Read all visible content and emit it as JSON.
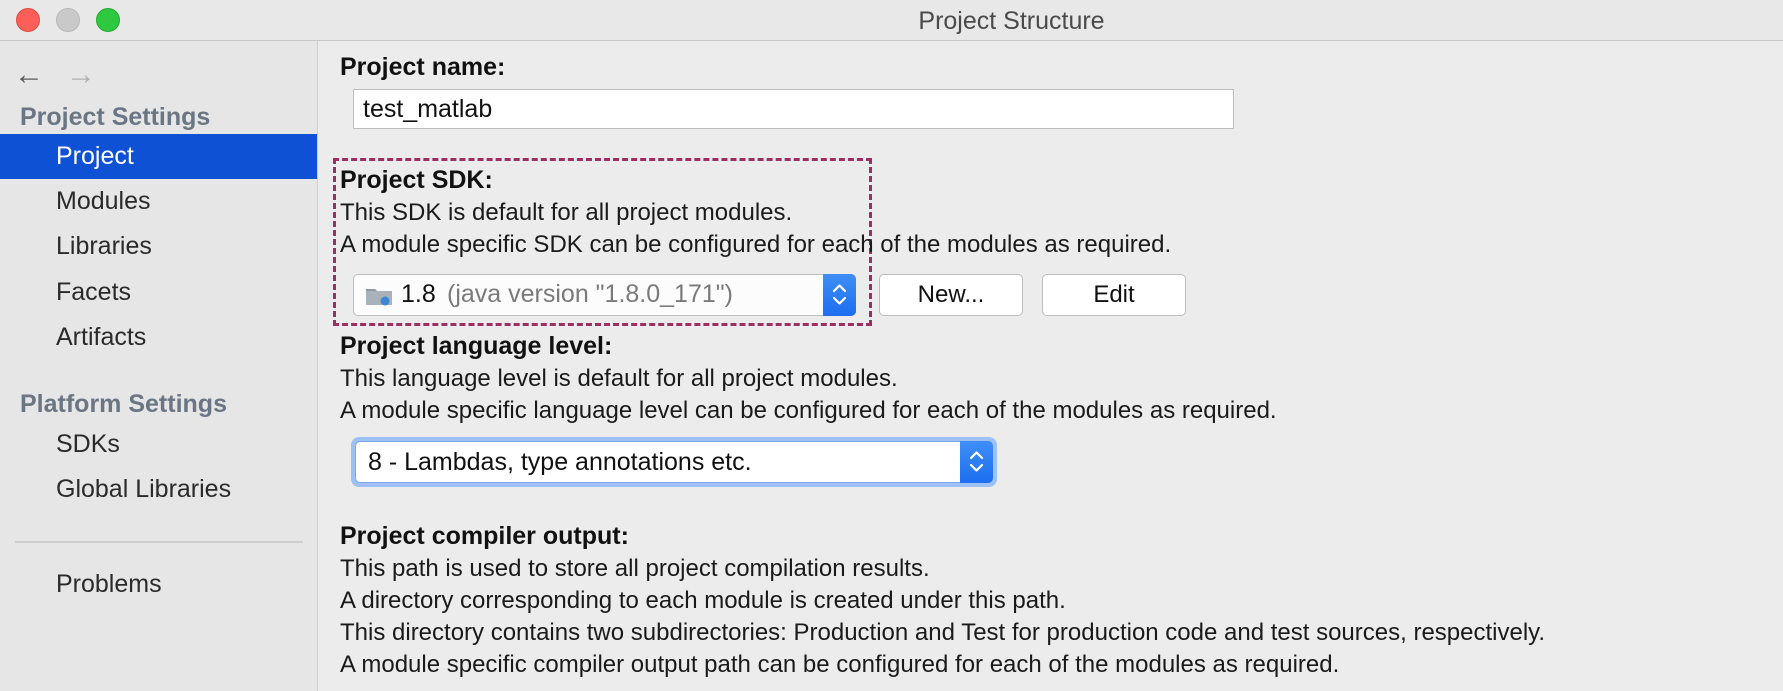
{
  "window": {
    "title": "Project Structure"
  },
  "sidebar": {
    "nav": {
      "back_icon": "←",
      "forward_icon": "→"
    },
    "sections": [
      {
        "header": "Project Settings",
        "items": [
          {
            "label": "Project",
            "selected": true
          },
          {
            "label": "Modules"
          },
          {
            "label": "Libraries"
          },
          {
            "label": "Facets"
          },
          {
            "label": "Artifacts"
          }
        ]
      },
      {
        "header": "Platform Settings",
        "items": [
          {
            "label": "SDKs"
          },
          {
            "label": "Global Libraries"
          }
        ]
      }
    ],
    "problems_label": "Problems"
  },
  "main": {
    "project_name": {
      "label": "Project name:",
      "value": "test_matlab"
    },
    "sdk": {
      "label": "Project SDK:",
      "desc1": "This SDK is default for all project modules.",
      "desc2": "A module specific SDK can be configured for each of the modules as required.",
      "selected_version": "1.8",
      "selected_detail": "(java version \"1.8.0_171\")",
      "new_button": "New...",
      "edit_button": "Edit"
    },
    "language_level": {
      "label": "Project language level:",
      "desc1": "This language level is default for all project modules.",
      "desc2": "A module specific language level can be configured for each of the modules as required.",
      "selected": "8 - Lambdas, type annotations etc."
    },
    "compiler_output": {
      "label": "Project compiler output:",
      "desc1": "This path is used to store all project compilation results.",
      "desc2": "A directory corresponding to each module is created under this path.",
      "desc3": "This directory contains two subdirectories: Production and Test for production code and test sources, respectively.",
      "desc4": "A module specific compiler output path can be configured for each of the modules as required."
    }
  },
  "colors": {
    "selection": "#0f51d4",
    "stepper_blue": "#1d6ef0",
    "highlight_dash": "#9c2f60",
    "section_header": "#6a7684"
  }
}
